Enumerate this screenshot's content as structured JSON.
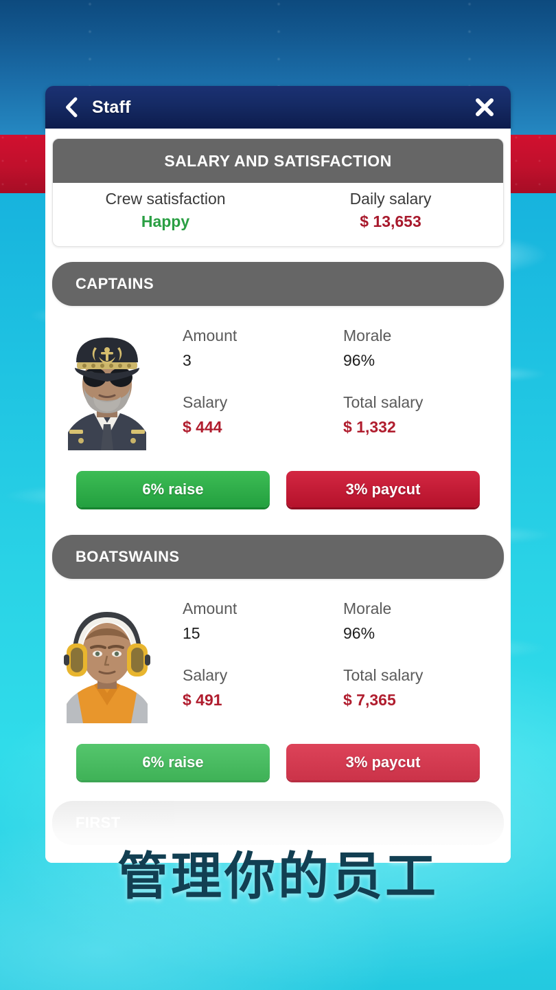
{
  "header": {
    "title": "Staff",
    "back_icon": "chevron-left-icon",
    "close_icon": "close-x-icon"
  },
  "summary_card": {
    "title": "SALARY AND SATISFACTION",
    "satisfaction_label": "Crew satisfaction",
    "satisfaction_value": "Happy",
    "salary_label": "Daily salary",
    "salary_value": "$ 13,653"
  },
  "sections": [
    {
      "name": "CAPTAINS",
      "avatar": "captain-avatar",
      "amount_label": "Amount",
      "amount_value": "3",
      "morale_label": "Morale",
      "morale_value": "96%",
      "salary_label": "Salary",
      "salary_value": "$ 444",
      "total_label": "Total salary",
      "total_value": "$ 1,332",
      "raise_label": "6% raise",
      "paycut_label": "3% paycut"
    },
    {
      "name": "BOATSWAINS",
      "avatar": "boatswain-avatar",
      "amount_label": "Amount",
      "amount_value": "15",
      "morale_label": "Morale",
      "morale_value": "96%",
      "salary_label": "Salary",
      "salary_value": "$ 491",
      "total_label": "Total salary",
      "total_value": "$ 7,365",
      "raise_label": "6% raise",
      "paycut_label": "3% paycut"
    }
  ],
  "next_section_partial": "FIRST",
  "caption": "管理你的员工",
  "colors": {
    "header_bg": "#152a64",
    "section_gray": "#666666",
    "money_red": "#b01d2e",
    "happy_green": "#2a9f43",
    "raise_green": "#23a03f",
    "paycut_red": "#c62234",
    "hull_blue": "#1a6ba6",
    "banner_red": "#c0102c",
    "water_cyan": "#2ad3e6"
  }
}
